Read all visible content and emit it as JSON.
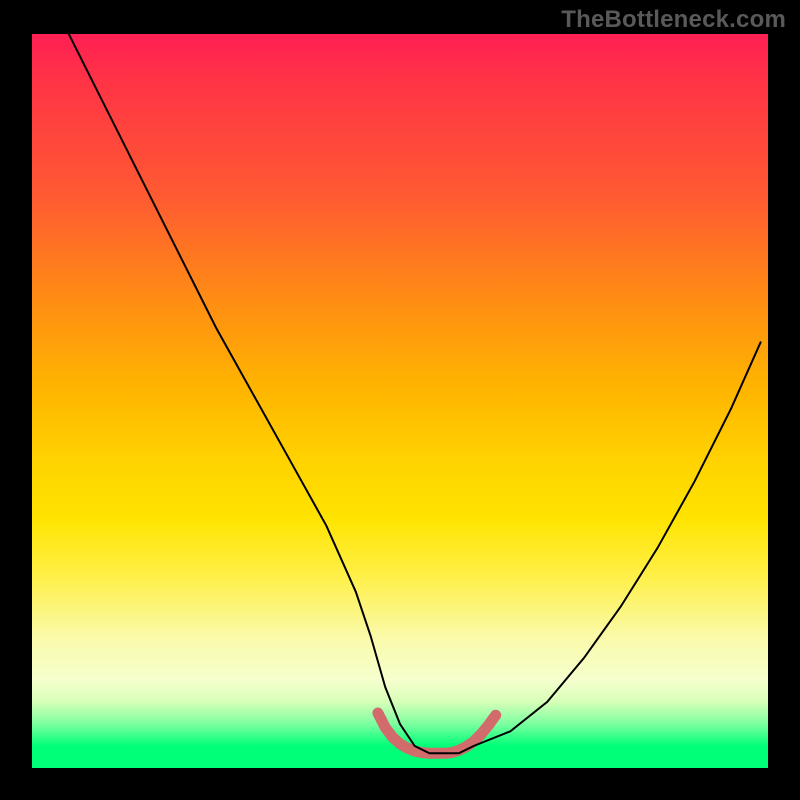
{
  "watermark": "TheBottleneck.com",
  "chart_data": {
    "type": "line",
    "title": "",
    "xlabel": "",
    "ylabel": "",
    "xlim": [
      0,
      100
    ],
    "ylim": [
      0,
      100
    ],
    "series": [
      {
        "name": "curve",
        "x": [
          5,
          10,
          15,
          20,
          25,
          30,
          35,
          40,
          44,
          46,
          48,
          50,
          52,
          54,
          56,
          58,
          60,
          65,
          70,
          75,
          80,
          85,
          90,
          95,
          99
        ],
        "y": [
          100,
          90,
          80,
          70,
          60,
          51,
          42,
          33,
          24,
          18,
          11,
          6,
          3,
          2,
          2,
          2,
          3,
          5,
          9,
          15,
          22,
          30,
          39,
          49,
          58
        ],
        "stroke": "#000000",
        "width": 2
      },
      {
        "name": "bottom-highlight",
        "x": [
          47,
          48,
          49,
          50,
          51,
          52,
          53,
          54,
          55,
          56,
          57,
          58,
          59,
          60,
          61,
          62,
          63
        ],
        "y": [
          7.5,
          5.5,
          4.2,
          3.3,
          2.7,
          2.3,
          2.1,
          2.0,
          2.0,
          2.0,
          2.1,
          2.4,
          2.9,
          3.6,
          4.6,
          5.8,
          7.2
        ],
        "stroke": "#d26b6b",
        "width": 11
      }
    ],
    "gradient_stops": [
      {
        "pos": 0,
        "color": "#ff1f54"
      },
      {
        "pos": 22,
        "color": "#ff5a32"
      },
      {
        "pos": 48,
        "color": "#ffb400"
      },
      {
        "pos": 66,
        "color": "#ffe400"
      },
      {
        "pos": 88,
        "color": "#f6ffce"
      },
      {
        "pos": 97,
        "color": "#00ff78"
      }
    ]
  }
}
